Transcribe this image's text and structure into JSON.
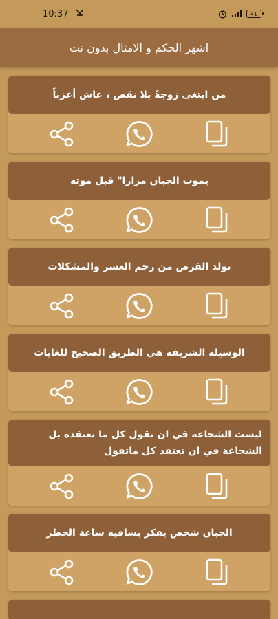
{
  "status_bar": {
    "time": "10:37",
    "battery": "41"
  },
  "app_bar": {
    "title": "اشهر الحكم و الامثال بدون نت"
  },
  "quotes": [
    {
      "text": "من ابتغى زوجةً بلا نقص ، عاش أعزباً"
    },
    {
      "text": "يموت الجبان مرارا\" قبل موته"
    },
    {
      "text": "تولد الفرص من رحم العسر والمشكلات"
    },
    {
      "text": "الوسيلة الشريفة هي الطريق الصحيح للغايات"
    },
    {
      "text": "ليست الشجاعة في ان تقول كل ما تعتقده بل الشجاعة في ان تعتقد كل ماتقول"
    },
    {
      "text": "الجبان شخص يفكر بساقيه ساعة الخطر"
    }
  ],
  "icons": {
    "share": "share-icon",
    "whatsapp": "whatsapp-icon",
    "copy": "copy-icon"
  },
  "colors": {
    "background": "#c49a5b",
    "app_bar": "#9c6b3f",
    "quote_box": "#8e6039",
    "card": "#cfa365",
    "icon": "#ffffff"
  }
}
